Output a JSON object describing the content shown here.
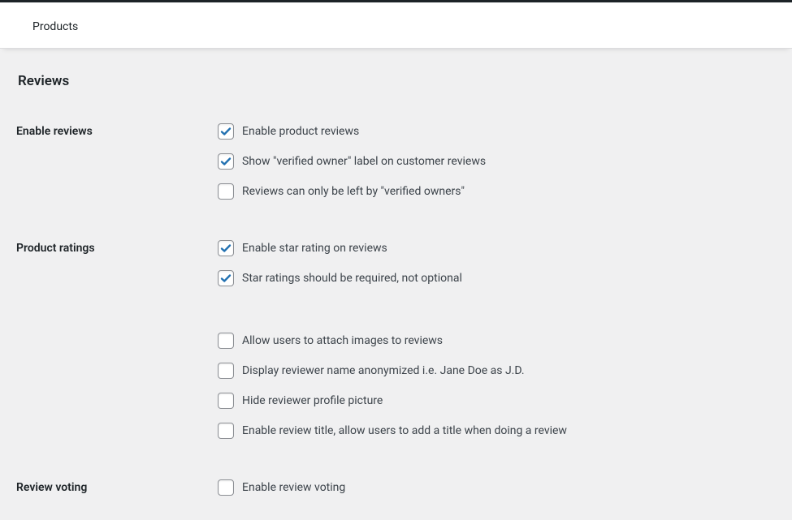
{
  "header": {
    "activeTab": "Products"
  },
  "section": {
    "title": "Reviews"
  },
  "rows": {
    "enableReviews": {
      "label": "Enable reviews",
      "options": [
        {
          "label": "Enable product reviews",
          "checked": true
        },
        {
          "label": "Show \"verified owner\" label on customer reviews",
          "checked": true
        },
        {
          "label": "Reviews can only be left by \"verified owners\"",
          "checked": false
        }
      ]
    },
    "productRatings": {
      "label": "Product ratings",
      "optionsA": [
        {
          "label": "Enable star rating on reviews",
          "checked": true
        },
        {
          "label": "Star ratings should be required, not optional",
          "checked": true
        }
      ],
      "optionsB": [
        {
          "label": "Allow users to attach images to reviews",
          "checked": false
        },
        {
          "label": "Display reviewer name anonymized i.e. Jane Doe as J.D.",
          "checked": false
        },
        {
          "label": "Hide reviewer profile picture",
          "checked": false
        },
        {
          "label": "Enable review title, allow users to add a title when doing a review",
          "checked": false
        }
      ]
    },
    "reviewVoting": {
      "label": "Review voting",
      "options": [
        {
          "label": "Enable review voting",
          "checked": false
        }
      ]
    }
  }
}
